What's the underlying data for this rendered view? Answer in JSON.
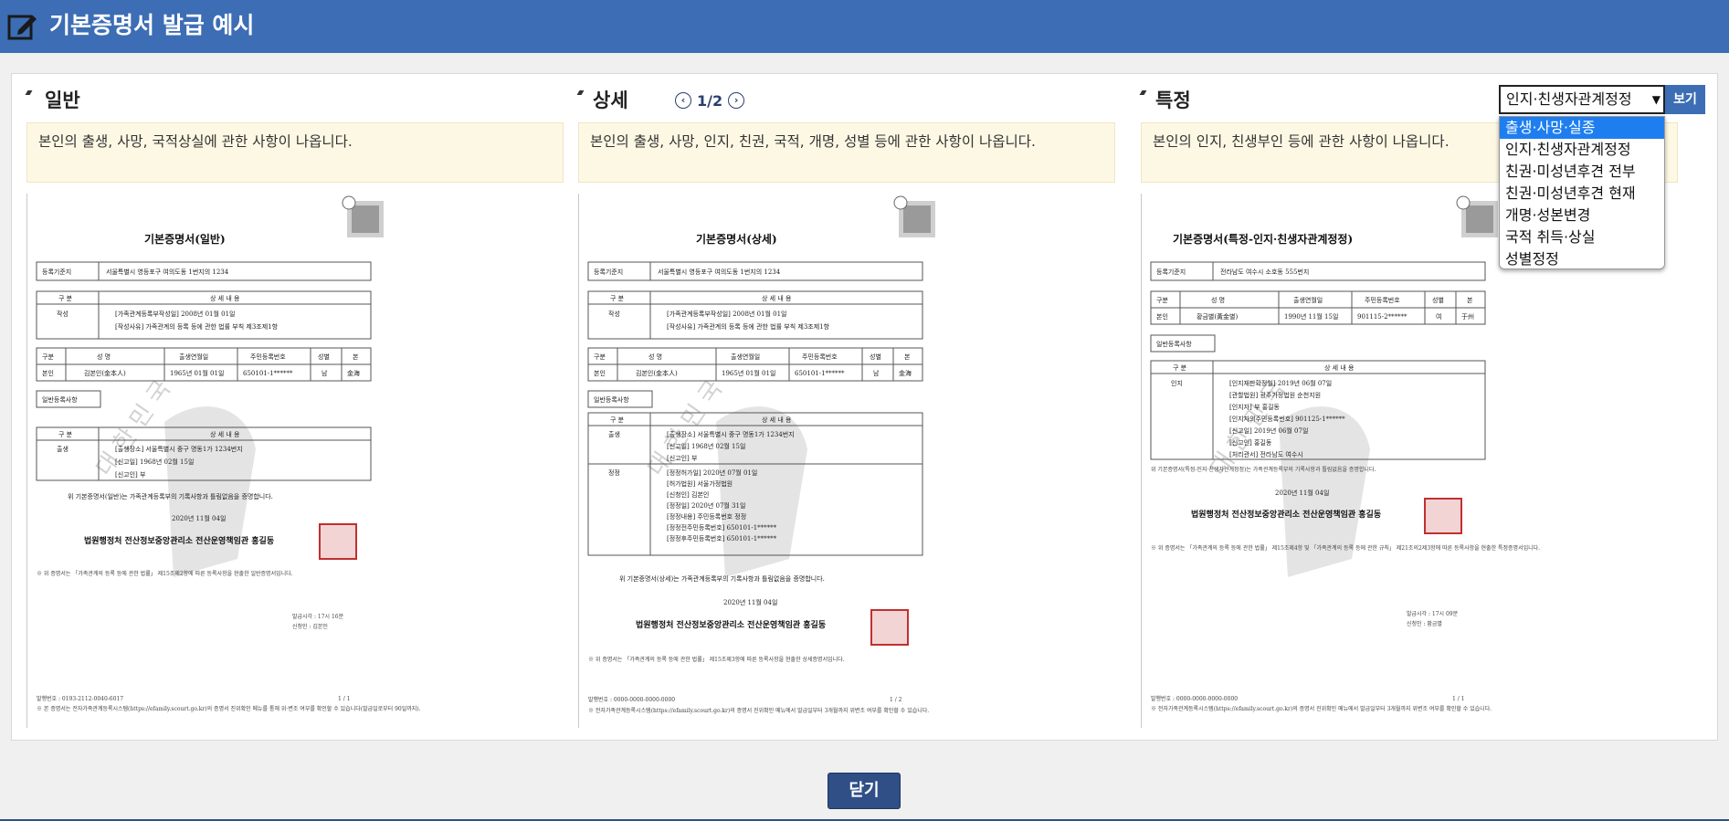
{
  "header": {
    "title": "기본증명서 발급 예시"
  },
  "sections": [
    {
      "title": "일반",
      "note": "본인의 출생, 사망, 국적상실에 관한 사항이 나옵니다.",
      "doc": {
        "title": "기본증명서(일반)",
        "reg_label": "등록기준지",
        "reg_value": "서울특별시 영등포구 여의도동 1번지의 1234",
        "h_gubun": "구 분",
        "h_detail": "상 세 내 용",
        "r1_label": "작성",
        "r1_l1": "[가족관계등록부작성일]    2008년 01월 01일",
        "r1_l2": "[작성사유]  가족관계의 등록 등에 관한 법률 부칙 제3조제1항",
        "p_h1": "구분",
        "p_h2": "성    명",
        "p_h3": "출생연월일",
        "p_h4": "주민등록번호",
        "p_h5": "성별",
        "p_h6": "본",
        "p_v1": "본인",
        "p_v2": "김본인(金本人)",
        "p_v3": "1965년 01월 01일",
        "p_v4": "650101-1******",
        "p_v5": "남",
        "p_v6": "金海",
        "gen_label": "일반등록사항",
        "e_label": "출생",
        "e_l1": "[출생장소]  서울특별시 중구 명동1가 1234번지",
        "e_l2": "[신고일]  1968년 02월 15일",
        "e_l3": "[신고인]  부",
        "cert": "위 기본증명서(일반)는 가족관계등록부의 기록사항과 틀림없음을 증명합니다.",
        "date": "2020년 11월 04일",
        "sign": "법원행정처 전산정보중앙관리소 전산운영책임관 홍길동",
        "remark": "※ 위 증명서는 「가족관계의 등록 등에 관한 법률」 제15조제2항에 따른 등록사항을 현출한 일반증명서입니다.",
        "issue_time": "발급시각 : 17시 16분",
        "applicant": "신청인 : 김본인",
        "issue_no": "발행번호 : 0193-2112-0040-6017",
        "page": "1 / 1",
        "foot": "※ 본 증명서는 전자가족관계등록시스템(https://efamily.scourt.go.kr)의 증명서 진위확인 메뉴를 통해 위·변조 여부를 확인할 수 있습니다(발급일로부터 90일까지)."
      }
    },
    {
      "title": "상세",
      "pager": "1/2",
      "note": "본인의 출생, 사망, 인지, 친권, 국적, 개명, 성별 등에 관한 사항이 나옵니다.",
      "doc": {
        "title": "기본증명서(상세)",
        "reg_label": "등록기준지",
        "reg_value": "서울특별시 영등포구 여의도동 1번지의 1234",
        "h_gubun": "구 분",
        "h_detail": "상 세 내 용",
        "r1_label": "작성",
        "r1_l1": "[가족관계등록부작성일]    2008년 01월 01일",
        "r1_l2": "[작성사유]  가족관계의 등록 등에 관한 법률 부칙 제3조제1항",
        "p_h1": "구분",
        "p_h2": "성    명",
        "p_h3": "출생연월일",
        "p_h4": "주민등록번호",
        "p_h5": "성별",
        "p_h6": "본",
        "p_v1": "본인",
        "p_v2": "김본인(金本人)",
        "p_v3": "1965년 01월 01일",
        "p_v4": "650101-1******",
        "p_v5": "남",
        "p_v6": "金海",
        "gen_label": "일반등록사항",
        "e_label": "출생",
        "e_l1": "[출생장소]  서울특별시 중구 명동1가 1234번지",
        "e_l2": "[신고일]  1968년 02월 15일",
        "e_l3": "[신고인]  부",
        "c_label": "정정",
        "c_l1": "[정정허가일]  2020년 07월 01일",
        "c_l2": "[허가법원]  서울가정법원",
        "c_l3": "[신청인]  김본인",
        "c_l4": "[정정일]  2020년 07월 31일",
        "c_l5": "[정정내용]  주민등록번호 정정",
        "c_l6": "[정정전주민등록번호]   650101-1******",
        "c_l7": "[정정후주민등록번호]   650101-1******",
        "cert": "위 기본증명서(상세)는 가족관계등록부의 기록사항과 틀림없음을 증명합니다.",
        "date": "2020년 11월 04일",
        "sign": "법원행정처 전산정보중앙관리소 전산운영책임관 홍길동",
        "remark": "※ 위 증명서는 「가족관계의 등록 등에 관한 법률」 제15조제3항에 따른 등록사항을 현출한 상세증명서입니다.",
        "issue_no": "발행번호 : 0000-0000-0000-0000",
        "page": "1 / 2",
        "foot": "※ 전자가족관계등록시스템(https://efamily.scourt.go.kr)의 증명서 진위확인 메뉴에서 발급일부터 3개월까지 위변조 여부를 확인할 수 있습니다."
      }
    },
    {
      "title": "특정",
      "note": "본인의 인지, 친생부인 등에 관한 사항이 나옵니다.",
      "doc": {
        "title": "기본증명서(특정-인지·친생자관계정정)",
        "reg_label": "등록기준지",
        "reg_value": "전라남도 여수시 소호동 555번지",
        "p_h1": "구분",
        "p_h2": "성    명",
        "p_h3": "출생연월일",
        "p_h4": "주민등록번호",
        "p_h5": "성별",
        "p_h6": "본",
        "p_v1": "본인",
        "p_v2": "황금별(黃金별)",
        "p_v3": "1990년 11월 15일",
        "p_v4": "901115-2******",
        "p_v5": "여",
        "p_v6": "于州",
        "gen_label": "일반등록사항",
        "h_gubun": "구 분",
        "h_detail": "상 세 내 용",
        "e_label": "인지",
        "e_l1": "[인지재판확정일]  2019년 06월 07일",
        "e_l2": "[관할법원]  광주가정법원 순천지원",
        "e_l3": "[인지자]  부 홍길동",
        "e_l4": "[인지자의주민등록번호]   901125-1******",
        "e_l5": "[신고일]  2019년 06월 07일",
        "e_l6": "[신고인]  홍길동",
        "e_l7": "[처리관서]  전라남도 여수시",
        "cert": "위 기본증명서(특정-인지·친생자관계정정)는 가족관계등록부의 기록사항과 틀림없음을 증명합니다.",
        "date": "2020년 11월 04일",
        "sign": "법원행정처 전산정보중앙관리소 전산운영책임관 홍길동",
        "remark": "※ 위 증명서는 「가족관계의 등록 등에 관한 법률」 제15조제4항 및 「가족관계의 등록 등에 관한 규칙」 제21조의2제3항에 따른 등록사항을 현출한 특정증명서입니다.",
        "issue_time": "발급시각 : 17시 09분",
        "applicant": "신청인 : 황금별",
        "issue_no": "발행번호 : 0000-0000-0000-0000",
        "page": "1 / 1",
        "foot": "※ 전자가족관계등록시스템(https://efamily.scourt.go.kr)의 증명서 진위확인 메뉴에서 발급일부터 3개월까지 위변조 여부를 확인할 수 있습니다."
      }
    }
  ],
  "select": {
    "value": "인지·친생자관계정정",
    "options": [
      "출생·사망·실종",
      "인지·친생자관계정정",
      "친권·미성년후견 전부",
      "친권·미성년후견 현재",
      "개명·성본변경",
      "국적 취득·상실",
      "성별정정"
    ],
    "highlighted_index": 0
  },
  "view_button": "보기",
  "close_button": "닫기",
  "watermark": "대 한 민 국",
  "colors": {
    "header": "#3c6db5",
    "note_bg": "#fdf8e4",
    "close_button": "#2f4f86",
    "highlight": "#1e7ef0"
  }
}
